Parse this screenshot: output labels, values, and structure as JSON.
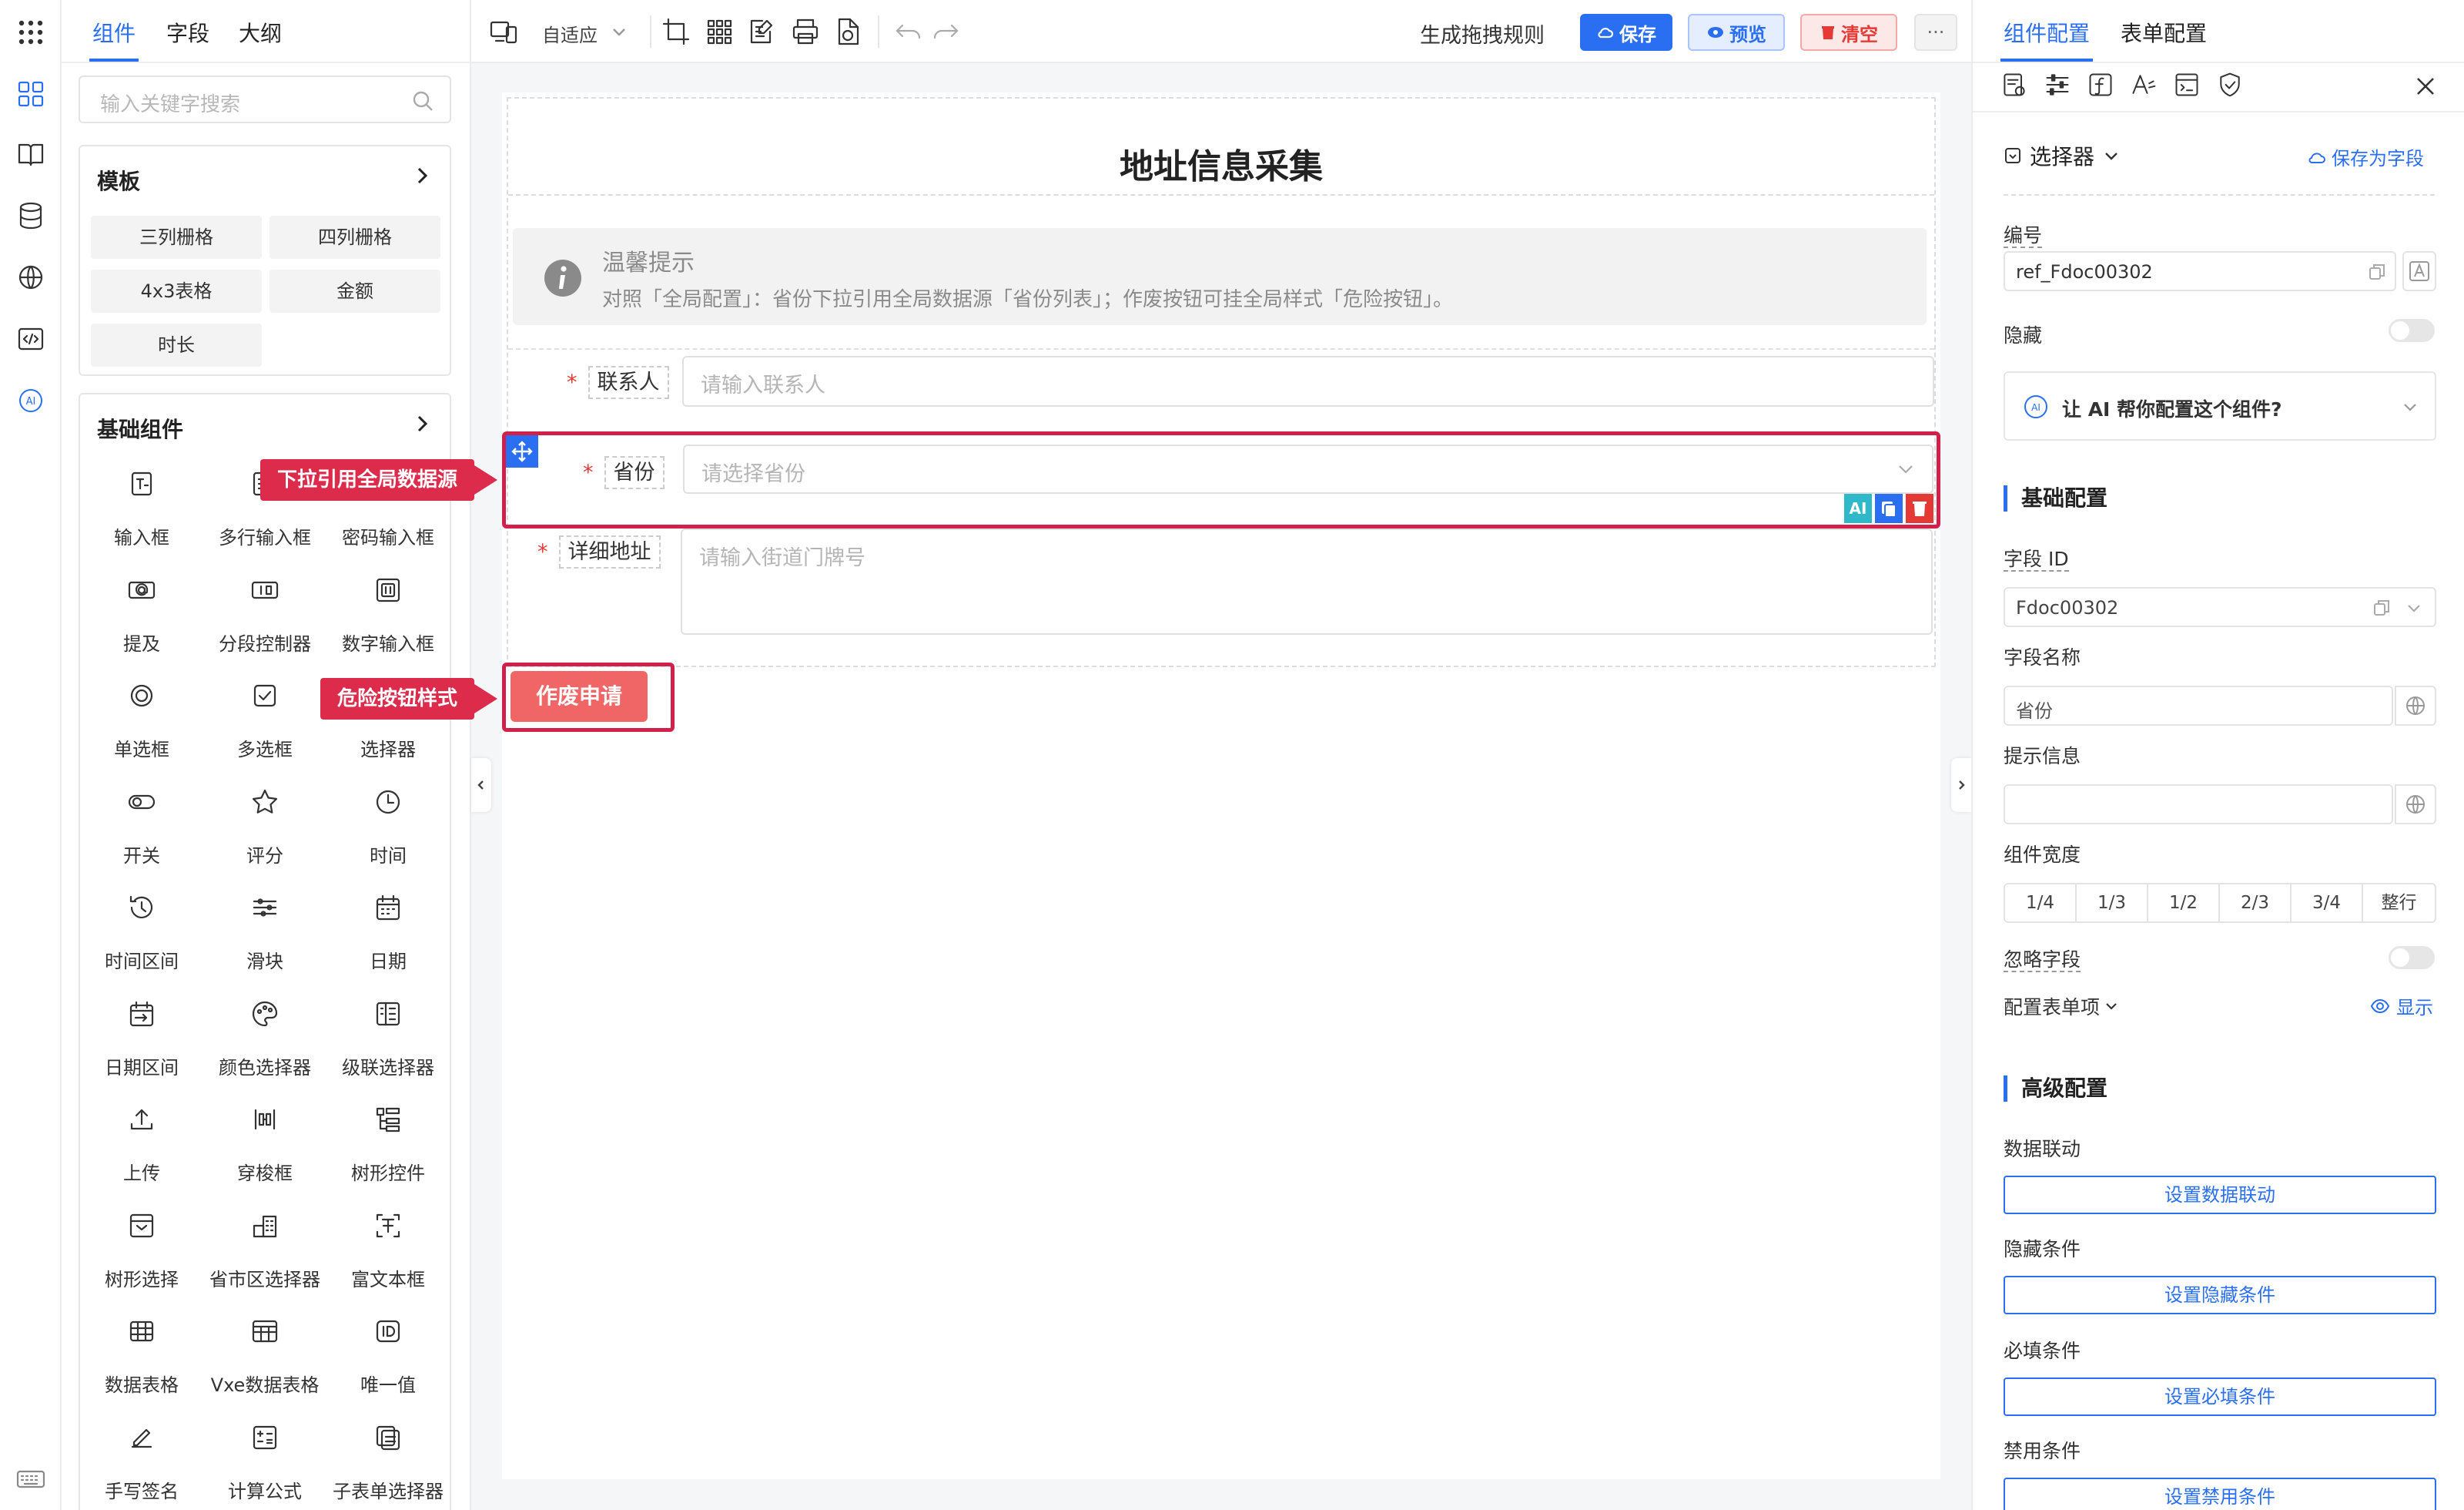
{
  "left_tabs": [
    "组件",
    "字段",
    "大纲"
  ],
  "search": {
    "placeholder": "输入关键字搜索"
  },
  "templates": {
    "title": "模板",
    "items": [
      "三列栅格",
      "四列栅格",
      "4x3表格",
      "金额",
      "时长"
    ]
  },
  "basic_components": {
    "title": "基础组件",
    "items": [
      {
        "label": "输入框",
        "icon": "text-input-icon"
      },
      {
        "label": "多行输入框",
        "icon": "textarea-icon"
      },
      {
        "label": "密码输入框",
        "icon": "password-icon"
      },
      {
        "label": "提及",
        "icon": "mention-icon"
      },
      {
        "label": "分段控制器",
        "icon": "segmented-icon"
      },
      {
        "label": "数字输入框",
        "icon": "number-input-icon"
      },
      {
        "label": "单选框",
        "icon": "radio-icon"
      },
      {
        "label": "多选框",
        "icon": "checkbox-icon"
      },
      {
        "label": "选择器",
        "icon": "select-icon"
      },
      {
        "label": "开关",
        "icon": "switch-icon"
      },
      {
        "label": "评分",
        "icon": "star-icon"
      },
      {
        "label": "时间",
        "icon": "clock-icon"
      },
      {
        "label": "时间区间",
        "icon": "time-range-icon"
      },
      {
        "label": "滑块",
        "icon": "slider-icon"
      },
      {
        "label": "日期",
        "icon": "calendar-icon"
      },
      {
        "label": "日期区间",
        "icon": "date-range-icon"
      },
      {
        "label": "颜色选择器",
        "icon": "palette-icon"
      },
      {
        "label": "级联选择器",
        "icon": "cascader-icon"
      },
      {
        "label": "上传",
        "icon": "upload-icon"
      },
      {
        "label": "穿梭框",
        "icon": "transfer-icon"
      },
      {
        "label": "树形控件",
        "icon": "tree-icon"
      },
      {
        "label": "树形选择",
        "icon": "tree-select-icon"
      },
      {
        "label": "省市区选择器",
        "icon": "region-icon"
      },
      {
        "label": "富文本框",
        "icon": "rich-text-icon"
      },
      {
        "label": "数据表格",
        "icon": "table-icon"
      },
      {
        "label": "Vxe数据表格",
        "icon": "vxe-table-icon"
      },
      {
        "label": "唯一值",
        "icon": "id-icon"
      },
      {
        "label": "手写签名",
        "icon": "pen-icon"
      },
      {
        "label": "计算公式",
        "icon": "calculator-icon"
      },
      {
        "label": "子表单选择器",
        "icon": "subform-icon"
      }
    ]
  },
  "toolbar": {
    "layout_mode": "自适应",
    "rule_label": "生成拖拽规则",
    "save": "保存",
    "preview": "预览",
    "clear": "清空",
    "more": "···"
  },
  "form": {
    "title": "地址信息采集",
    "tip_title": "温馨提示",
    "tip_text": "对照「全局配置」：省份下拉引用全局数据源「省份列表」；作废按钮可挂全局样式「危险按钮」。",
    "fields": [
      {
        "label": "联系人",
        "placeholder": "请输入联系人"
      },
      {
        "label": "省份",
        "placeholder": "请选择省份"
      },
      {
        "label": "详细地址",
        "placeholder": "请输入街道门牌号"
      }
    ],
    "required_mark": "*",
    "void_button": "作废申请",
    "ai_badge": "AI"
  },
  "callouts": {
    "dropdown": "下拉引用全局数据源",
    "danger": "危险按钮样式"
  },
  "right_panel": {
    "tabs": [
      "组件配置",
      "表单配置"
    ],
    "component_type": "选择器",
    "save_as_field": "保存为字段",
    "ref_label": "编号",
    "ref_value": "ref_Fdoc00302",
    "hidden_label": "隐藏",
    "ai_prompt": "让 AI 帮你配置这个组件?",
    "basic_title": "基础配置",
    "field_id_label": "字段 ID",
    "field_id_value": "Fdoc00302",
    "field_name_label": "字段名称",
    "field_name_value": "省份",
    "hint_label": "提示信息",
    "hint_value": "",
    "width_label": "组件宽度",
    "width_options": [
      "1/4",
      "1/3",
      "1/2",
      "2/3",
      "3/4",
      "整行"
    ],
    "ignore_label": "忽略字段",
    "form_items_label": "配置表单项",
    "show_label": "显示",
    "advanced_title": "高级配置",
    "linkage_label": "数据联动",
    "linkage_btn": "设置数据联动",
    "hide_cond_label": "隐藏条件",
    "hide_cond_btn": "设置隐藏条件",
    "required_cond_label": "必填条件",
    "required_cond_btn": "设置必填条件",
    "disable_cond_label": "禁用条件",
    "disable_cond_btn": "设置禁用条件"
  },
  "colors": {
    "accent": "#2a6ff2",
    "danger": "#dc2b4b",
    "danger_button": "#f06565"
  }
}
